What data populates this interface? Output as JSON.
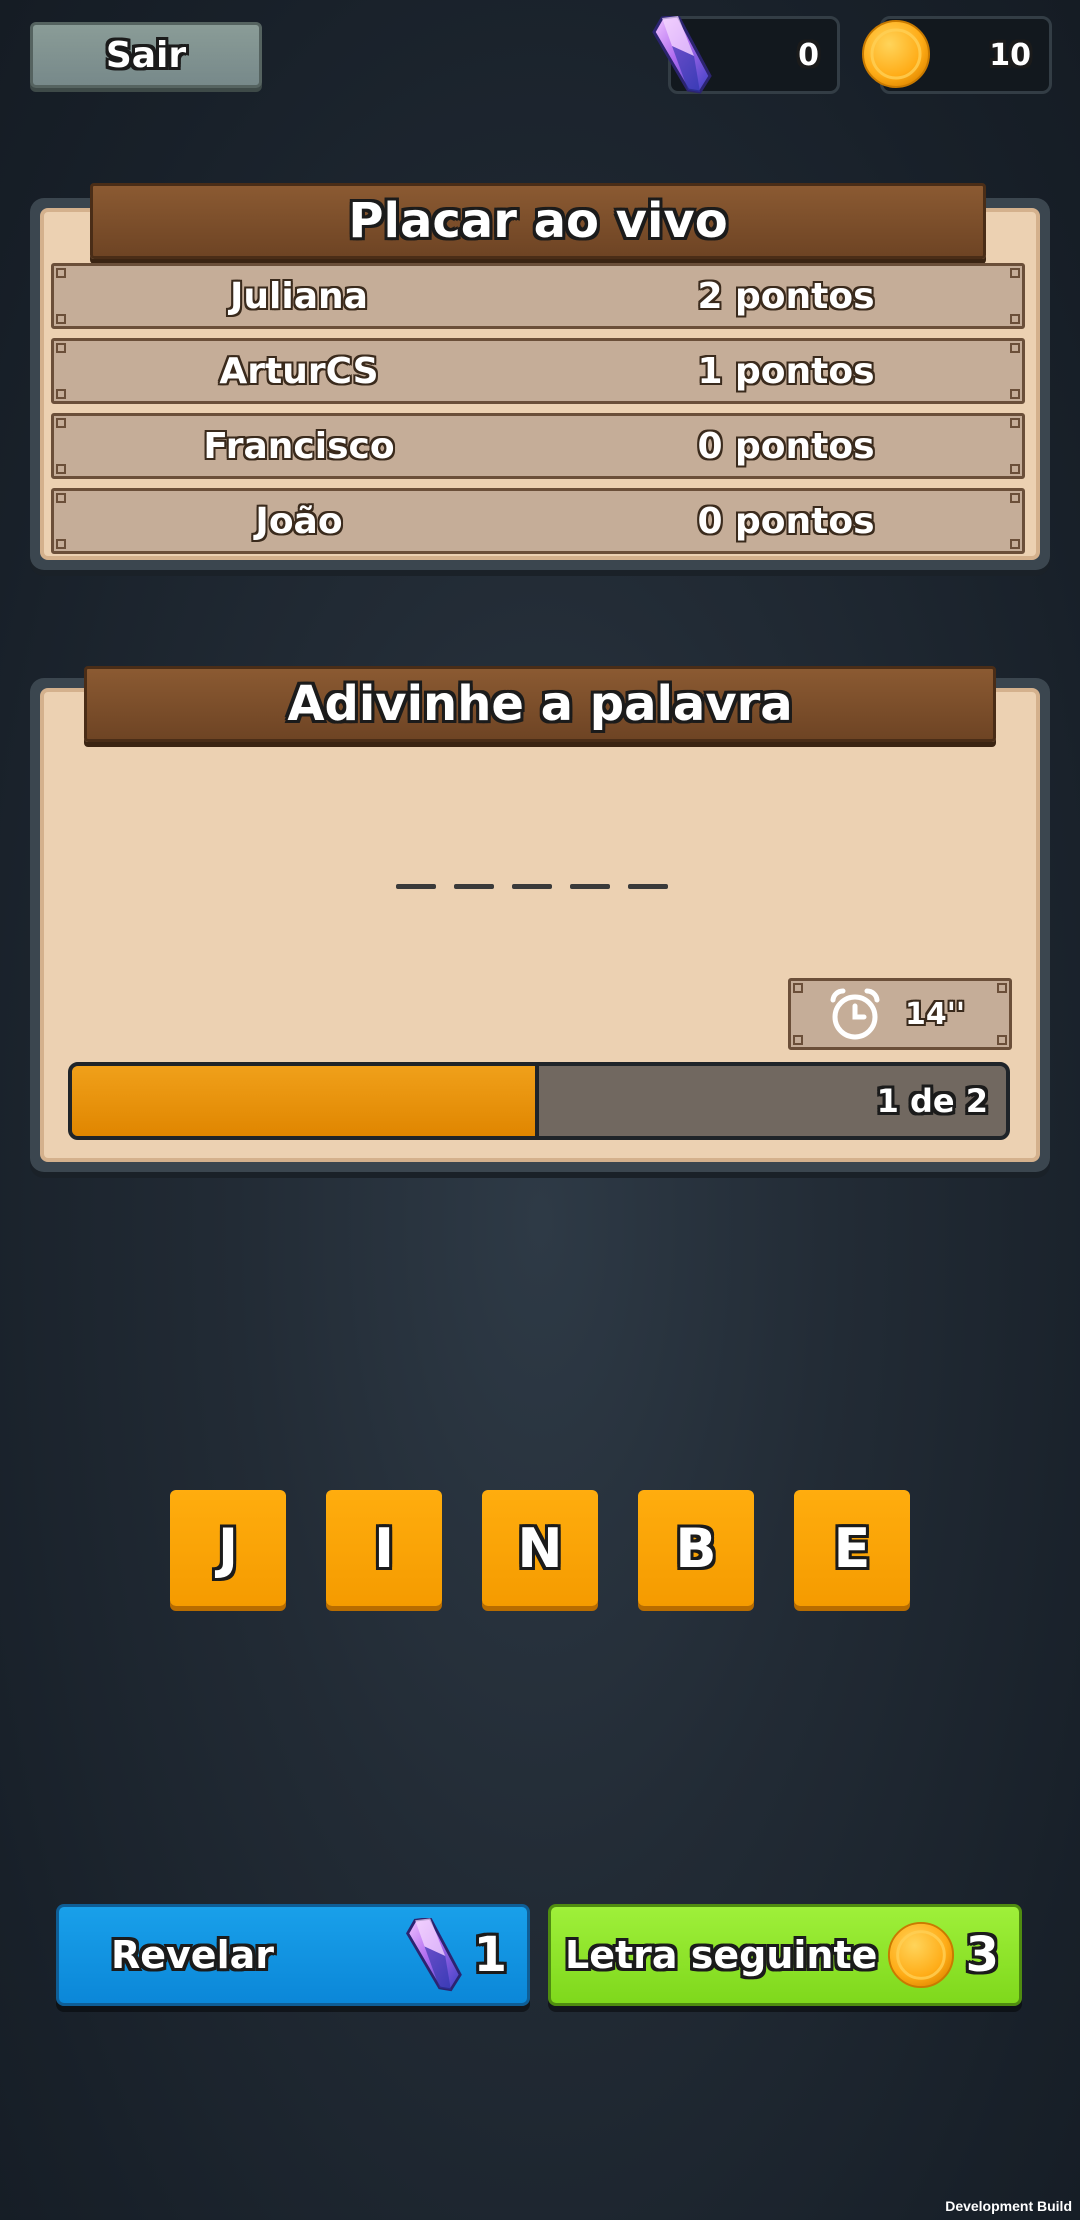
{
  "header": {
    "exit_label": "Sair",
    "gems": "0",
    "coins": "10",
    "gem_icon": "crystal-icon",
    "coin_icon": "coin-icon"
  },
  "scoreboard": {
    "title": "Placar ao vivo",
    "rows": [
      {
        "name": "Juliana",
        "points": "2 pontos"
      },
      {
        "name": "ArturCS",
        "points": "1 pontos"
      },
      {
        "name": "Francisco",
        "points": "0 pontos"
      },
      {
        "name": "João",
        "points": "0 pontos"
      }
    ]
  },
  "guess": {
    "title": "Adivinhe a palavra",
    "blank_count": 5,
    "timer": "14''",
    "timer_icon": "alarm-clock-icon",
    "progress_label": "1 de 2",
    "progress_fraction": 0.5
  },
  "tiles": [
    "J",
    "I",
    "N",
    "B",
    "E"
  ],
  "actions": {
    "reveal_label": "Revelar",
    "reveal_cost": "1",
    "next_label": "Letra seguinte",
    "next_cost": "3"
  },
  "colors": {
    "tile": "#ffad0e",
    "reveal_button": "#12a0e9",
    "next_button": "#8fe42b",
    "progress_fill": "#e8920a"
  },
  "footer": {
    "dev_build": "Development Build"
  }
}
